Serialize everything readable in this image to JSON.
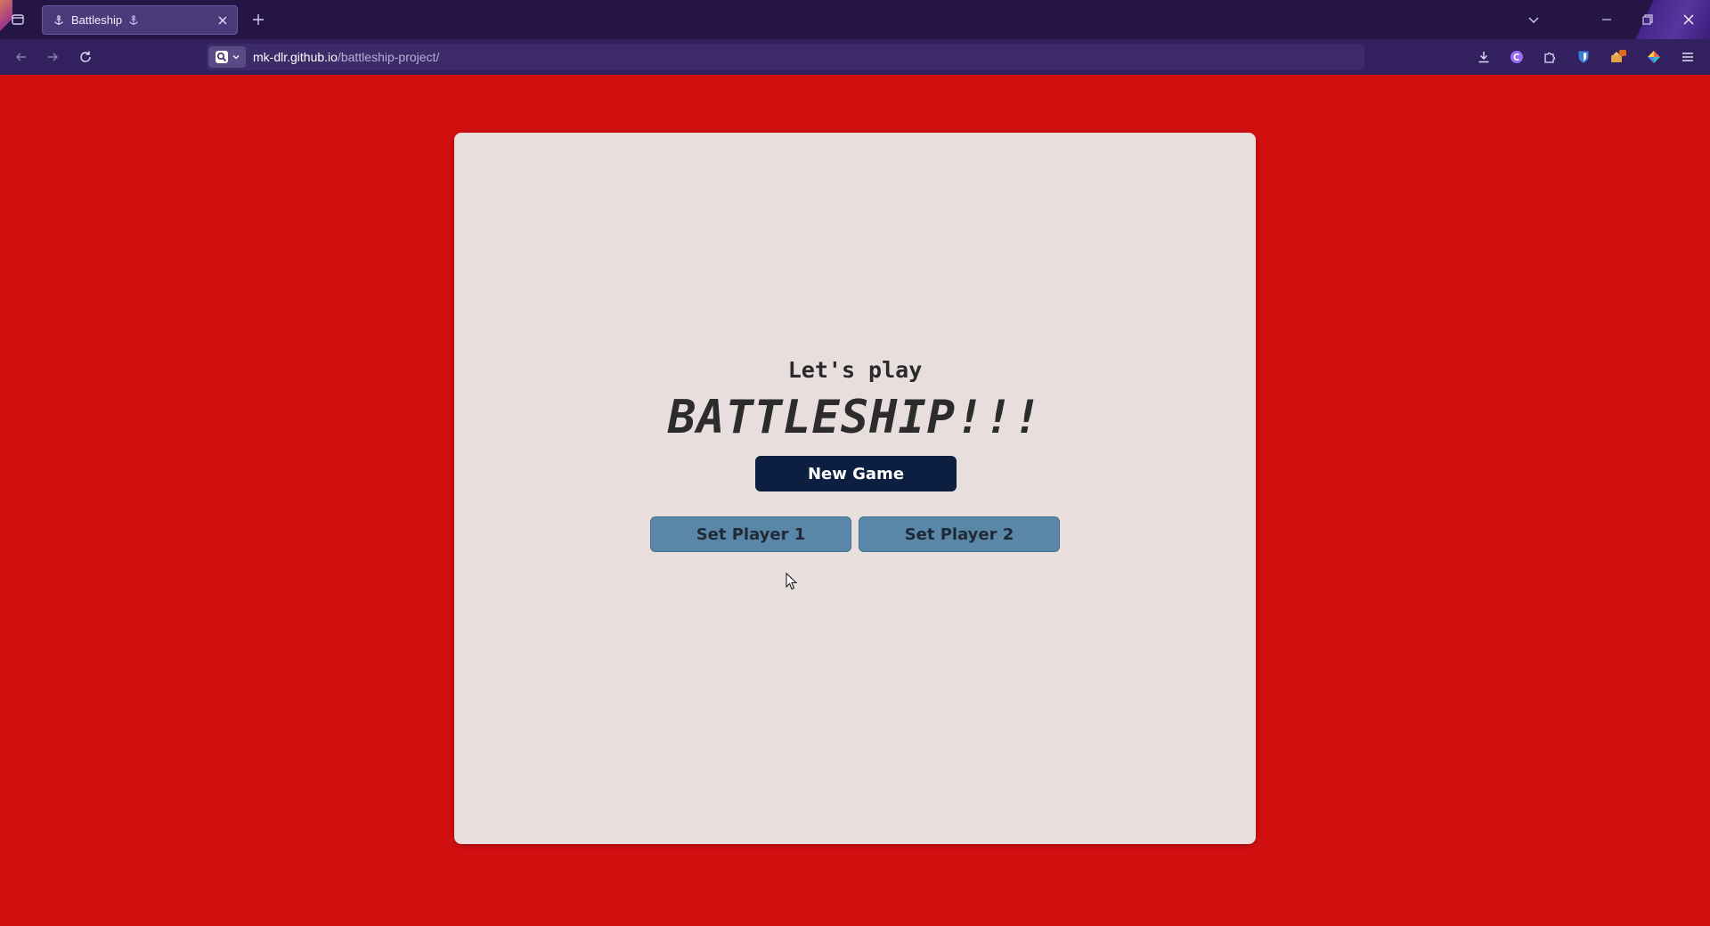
{
  "browser": {
    "tab": {
      "title": "Battleship"
    },
    "url": {
      "host": "mk-dlr.github.io",
      "path": "/battleship-project/"
    }
  },
  "page": {
    "intro": "Let's play",
    "headline": "BATTLESHIP!!!",
    "new_game_label": "New Game",
    "set_player1_label": "Set Player 1",
    "set_player2_label": "Set Player 2"
  },
  "colors": {
    "page_background": "#d10f0f",
    "card_background": "#e8dedd",
    "primary_button": "#0c1f40",
    "secondary_button": "#5a86a8",
    "browser_chrome": "#251545"
  },
  "icons": {
    "tab_list": "tab-list-icon",
    "favicon": "anchor-icon",
    "tab_close": "close-icon",
    "new_tab": "plus-icon",
    "back": "arrow-left-icon",
    "forward": "arrow-right-icon",
    "reload": "reload-icon",
    "search_engine": "search-icon",
    "downloads": "download-icon",
    "extensions": "puzzle-icon",
    "menu": "hamburger-icon"
  }
}
